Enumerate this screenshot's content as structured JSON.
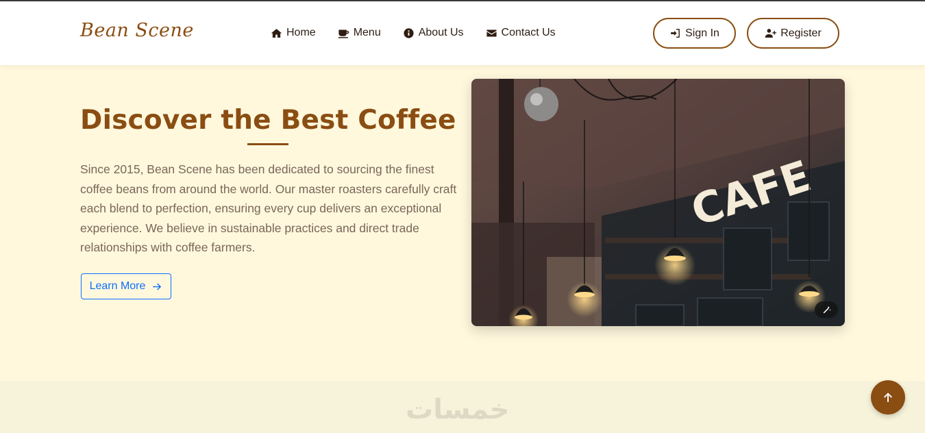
{
  "header": {
    "brand": "Bean Scene",
    "nav": [
      {
        "label": "Home",
        "icon": "home-icon"
      },
      {
        "label": "Menu",
        "icon": "coffee-cup-icon"
      },
      {
        "label": "About Us",
        "icon": "info-icon"
      },
      {
        "label": "Contact Us",
        "icon": "envelope-icon"
      }
    ],
    "sign_in_label": "Sign In",
    "register_label": "Register"
  },
  "hero": {
    "title": "Discover the Best Coffee",
    "description": "Since 2015, Bean Scene has been dedicated to sourcing the finest coffee beans from around the world. Our master roasters carefully craft each blend to perfection, ensuring every cup delivers an exceptional experience. We believe in sustainable practices and direct trade relationships with coffee farmers.",
    "cta_label": "Learn More",
    "image_sign_text": "CAFE"
  },
  "watermark": "خمسات",
  "colors": {
    "brand": "#8a4d12",
    "page_bg": "#fff8dd",
    "link_blue": "#0d6efd",
    "text_muted": "#7a6658"
  }
}
